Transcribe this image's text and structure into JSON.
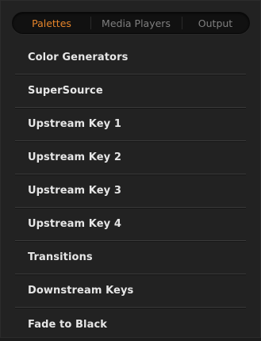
{
  "tabs": [
    {
      "label": "Palettes",
      "active": true
    },
    {
      "label": "Media Players",
      "active": false
    },
    {
      "label": "Output",
      "active": false
    }
  ],
  "menu": {
    "items": [
      {
        "label": "Color Generators"
      },
      {
        "label": "SuperSource"
      },
      {
        "label": "Upstream Key 1"
      },
      {
        "label": "Upstream Key 2"
      },
      {
        "label": "Upstream Key 3"
      },
      {
        "label": "Upstream Key 4"
      },
      {
        "label": "Transitions"
      },
      {
        "label": "Downstream Keys"
      },
      {
        "label": "Fade to Black"
      }
    ]
  },
  "colors": {
    "accent": "#e5842a",
    "background": "#222222",
    "text": "#e6e6e6",
    "inactive_tab_text": "#7f7f7f"
  }
}
